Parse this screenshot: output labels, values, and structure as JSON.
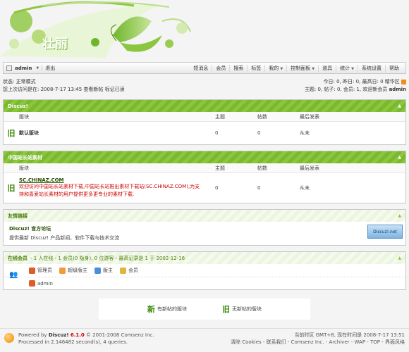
{
  "banner": {
    "logo_text": "壮丽"
  },
  "nav": {
    "user": "admin",
    "logout": "退出",
    "items": [
      "短消息",
      "会员",
      "搜索",
      "标签",
      "我的",
      "控制面板",
      "道具",
      "统计",
      "系统设置",
      "帮助"
    ]
  },
  "status": {
    "left_line1": "状态: 正常模式",
    "left_line2": "您上次访问是在: 2008-7-17 13:45 查看新帖  标记已读",
    "right_line1": "今日: 0, 昨日: 0, 最高日: 0  精华区",
    "right_line2_prefix": "主题: 0, 帖子: 0, 会员: 1, 欢迎新会员",
    "right_line2_member": "admin"
  },
  "discuz_box": {
    "title": "Discuz!",
    "headers": [
      "版块",
      "主题",
      "帖数",
      "最后发表"
    ],
    "rows": [
      {
        "name": "默认版块",
        "topics": "0",
        "posts": "0",
        "last": "从未"
      }
    ]
  },
  "chinaz_box": {
    "title": "中国站长站素材",
    "headers": [
      "版块",
      "主题",
      "帖数",
      "最后发表"
    ],
    "rows": [
      {
        "name": "SC.CHINAZ.COM",
        "desc1": "欢迎访问中国站长站素材下载,中国站长站推出素材下载站(SC.CHINAZ.COM),为支",
        "desc2": "持和喜爱站长素材的用户提供更多更专业的素材下载.",
        "topics": "0",
        "posts": "0",
        "last": "从未"
      }
    ]
  },
  "links_box": {
    "title": "友情链接",
    "link_title": "Discuz! 官方论坛",
    "link_desc": "提供最新 Discuz! 产品新闻、软件下载与技术交流",
    "badge": "Discuz!.net"
  },
  "online_box": {
    "title": "在线会员",
    "stats": "- 1 人在线 - 1 会员(0 隐身), 0 位游客 - 最高记录是 1 于 2002-12-16",
    "roles": [
      "管理员",
      "超级版主",
      "版主",
      "会员"
    ],
    "online_user": "admin"
  },
  "legend": {
    "new": "有新帖的版块",
    "old": "无新帖的版块",
    "new_icon": "新",
    "old_icon": "旧"
  },
  "footer": {
    "powered_prefix": "Powered by",
    "powered_name": "Discuz!",
    "version": "6.1.0",
    "copyright": "© 2001-2008 Comsenz Inc.",
    "processed": "Processed in 2.146482 second(s), 4 queries.",
    "time": "当前时区 GMT+8, 现在时间是 2008-7-17 13:51",
    "links": "清除 Cookies - 联系我们 - Comsenz Inc. - Archiver - WAP - TOP - 界面风格"
  },
  "colors": {
    "accent": "#8cc63f",
    "accent_dark": "#7ab82e",
    "alert": "#cc0000"
  }
}
